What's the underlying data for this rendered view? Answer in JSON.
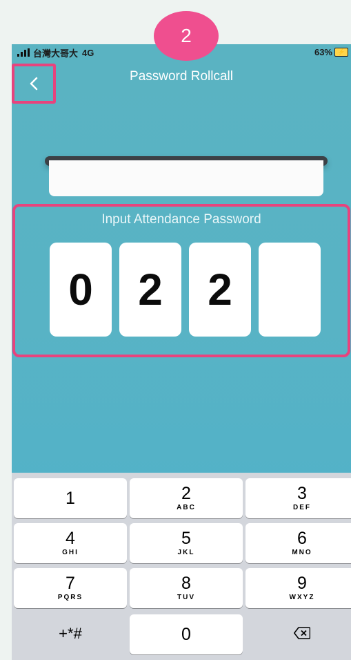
{
  "step_badge": "2",
  "status_bar": {
    "carrier": "台灣大哥大",
    "network": "4G",
    "battery": "63%"
  },
  "nav": {
    "back_icon": "chevron-left-icon",
    "title": "Password Rollcall"
  },
  "prompt": "Input Attendance Password",
  "password_digits": [
    "0",
    "2",
    "2",
    ""
  ],
  "keypad": {
    "keys": [
      {
        "num": "1",
        "letters": ""
      },
      {
        "num": "2",
        "letters": "ABC"
      },
      {
        "num": "3",
        "letters": "DEF"
      },
      {
        "num": "4",
        "letters": "GHI"
      },
      {
        "num": "5",
        "letters": "JKL"
      },
      {
        "num": "6",
        "letters": "MNO"
      },
      {
        "num": "7",
        "letters": "PQRS"
      },
      {
        "num": "8",
        "letters": "TUV"
      },
      {
        "num": "9",
        "letters": "WXYZ"
      }
    ],
    "symbols": "+*#",
    "zero": "0",
    "delete_icon": "backspace-icon"
  },
  "colors": {
    "accent": "#e8437d",
    "badge": "#ef4f8f",
    "background": "#58b3c5"
  }
}
